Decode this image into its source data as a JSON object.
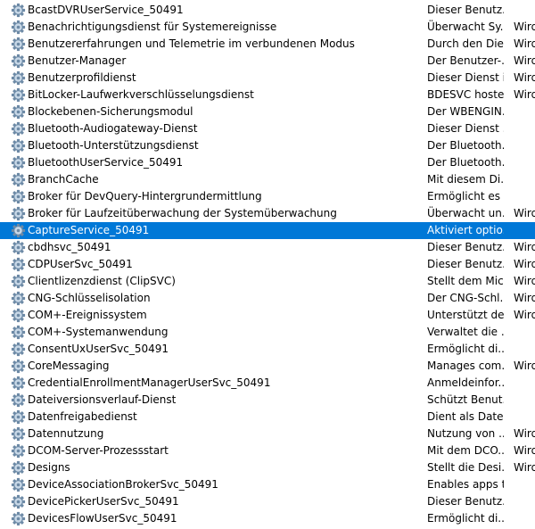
{
  "services": [
    {
      "name": "BcastDVRUserService_50491",
      "description": "Dieser Benutz...",
      "status": ""
    },
    {
      "name": "Benachrichtigungsdienst für Systemereignisse",
      "description": "Überwacht Sy...",
      "status": "Wird"
    },
    {
      "name": "Benutzererfahrungen und Telemetrie im verbundenen Modus",
      "description": "Durch den Die...",
      "status": "Wird"
    },
    {
      "name": "Benutzer-Manager",
      "description": "Der Benutzer-...",
      "status": "Wird"
    },
    {
      "name": "Benutzerprofildienst",
      "description": "Dieser Dienst i...",
      "status": "Wird"
    },
    {
      "name": "BitLocker-Laufwerkverschlüsselungsdienst",
      "description": "BDESVC hoste...",
      "status": "Wird"
    },
    {
      "name": "Blockebenen-Sicherungsmodul",
      "description": "Der WBENGIN...",
      "status": ""
    },
    {
      "name": "Bluetooth-Audiogateway-Dienst",
      "description": "Dieser Dienst ...",
      "status": ""
    },
    {
      "name": "Bluetooth-Unterstützungsdienst",
      "description": "Der Bluetooth...",
      "status": ""
    },
    {
      "name": "BluetoothUserService_50491",
      "description": "Der Bluetooth...",
      "status": ""
    },
    {
      "name": "BranchCache",
      "description": "Mit diesem Di...",
      "status": ""
    },
    {
      "name": "Broker für DevQuery-Hintergrundermittlung",
      "description": "Ermöglicht es ...",
      "status": ""
    },
    {
      "name": "Broker für Laufzeitüberwachung der Systemüberwachung",
      "description": "Überwacht un...",
      "status": "Wird"
    },
    {
      "name": "CaptureService_50491",
      "description": "Aktiviert optio...",
      "status": ""
    },
    {
      "name": "cbdhsvc_50491",
      "description": "Dieser Benutz...",
      "status": "Wird"
    },
    {
      "name": "CDPUserSvc_50491",
      "description": "Dieser Benutz...",
      "status": "Wird"
    },
    {
      "name": "Clientlizenzdienst (ClipSVC)",
      "description": "Stellt dem Mic...",
      "status": "Wird"
    },
    {
      "name": "CNG-Schlüsselisolation",
      "description": "Der CNG-Schl...",
      "status": "Wird"
    },
    {
      "name": "COM+-Ereignissystem",
      "description": "Unterstützt de...",
      "status": "Wird"
    },
    {
      "name": "COM+-Systemanwendung",
      "description": "Verwaltet die ...",
      "status": ""
    },
    {
      "name": "ConsentUxUserSvc_50491",
      "description": "Ermöglicht di...",
      "status": ""
    },
    {
      "name": "CoreMessaging",
      "description": "Manages com...",
      "status": "Wird"
    },
    {
      "name": "CredentialEnrollmentManagerUserSvc_50491",
      "description": "Anmeldeinfor...",
      "status": ""
    },
    {
      "name": "Dateiversionsverlauf-Dienst",
      "description": "Schützt Benut...",
      "status": ""
    },
    {
      "name": "Datenfreigabedienst",
      "description": "Dient als Date...",
      "status": ""
    },
    {
      "name": "Datennutzung",
      "description": "Nutzung von ...",
      "status": "Wird"
    },
    {
      "name": "DCOM-Server-Prozessstart",
      "description": "Mit dem DCO...",
      "status": "Wird"
    },
    {
      "name": "Designs",
      "description": "Stellt die Desi...",
      "status": "Wird"
    },
    {
      "name": "DeviceAssociationBrokerSvc_50491",
      "description": "Enables apps t...",
      "status": ""
    },
    {
      "name": "DevicePickerUserSvc_50491",
      "description": "Dieser Benutz...",
      "status": ""
    },
    {
      "name": "DevicesFlowUserSvc_50491",
      "description": "Ermöglicht di...",
      "status": ""
    }
  ],
  "selected_index": 13,
  "icon": "gear-icon",
  "colors": {
    "selection": "#0078d7",
    "text": "#000000",
    "selected_text": "#ffffff",
    "gear_body": "#6d8aa6",
    "gear_light": "#c9d9e8"
  }
}
